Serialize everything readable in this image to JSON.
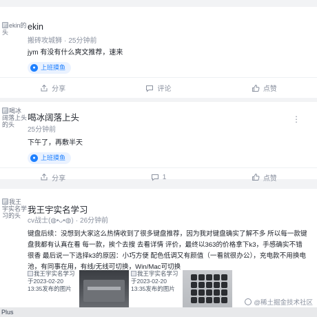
{
  "posts": [
    {
      "avatar_alt": "ekin的头",
      "author": "ekin",
      "title_role": "搬砖攻城狮",
      "time": "25分钟前",
      "content": "jym 有没有什么爽文推荐，速来",
      "topic": "上班摸鱼",
      "actions": {
        "share": "分享",
        "comment": "评论",
        "like": "点赞"
      }
    },
    {
      "avatar_alt": "喝冰阔落上头的头",
      "author": "喝冰阔落上头",
      "time": "25分钟前",
      "content": "下午了，再敷半天",
      "topic": "上班摸鱼",
      "actions": {
        "share": "分享",
        "comment": "1",
        "like": "点赞"
      },
      "more": "⋮"
    },
    {
      "avatar_alt": "我王宇实名学习的头",
      "author": "我王宇实名学习",
      "title_role": "cv战士",
      "emoji": "(◍•ᴗ•◍)",
      "time": "26分钟前",
      "content": "键盘后续：没想到大家这么热情收到了很多键盘推荐，因为我对键盘确实了解不多 所以每一款键盘我都有认真在看 每一款，挨个去搜 去看详情 评价，最终以363的价格拿下k3，手感确实不错 很香 最后说一下选择k3的原因：小巧方便 配色低调又有颜值（一看就很办公），充电款不用换电池，有同事在用，有线/无线可切换，Win/Mac可切换",
      "images": [
        {
          "alt": "我王宇实名学习于2023-02-20 13:35发布的图片"
        },
        {
          "alt": ""
        },
        {
          "alt": "我王宇实名学习于2023-02-20 13:35发布的图片"
        },
        {
          "alt": ""
        }
      ]
    }
  ],
  "status_bar": "Plus",
  "watermark": "@稀土掘金技术社区",
  "colors": {
    "accent": "#1e80ff",
    "muted": "#8a919f",
    "page_bg": "#f2f3f5"
  }
}
